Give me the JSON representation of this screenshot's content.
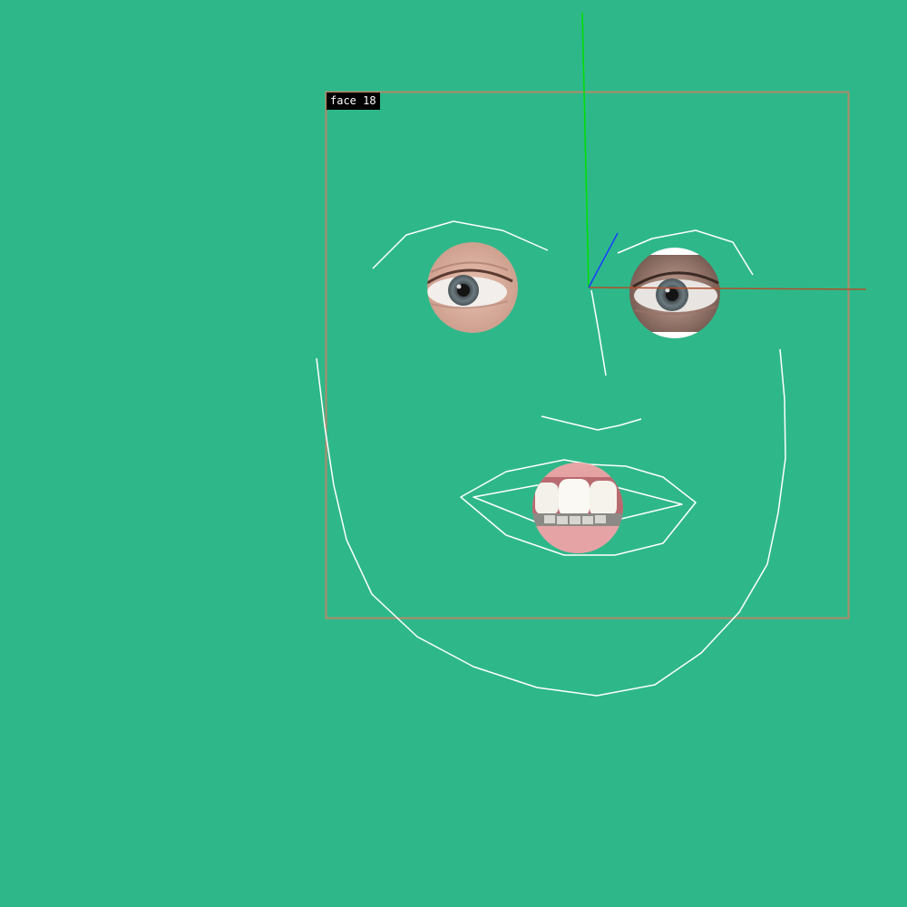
{
  "background_color": "#2eb88a",
  "detection": {
    "label": "face 18",
    "box_color": "#b08a6a",
    "label_bg": "#000000",
    "label_text_color": "#ffffff"
  },
  "landmark_color": "#ffffff",
  "axes": {
    "x_color": "#b0502a",
    "y_color": "#00e000",
    "z_color": "#1a3cff"
  },
  "icons": {
    "left_eye": "eye-photo",
    "right_eye": "eye-photo",
    "mouth": "mouth-photo"
  }
}
